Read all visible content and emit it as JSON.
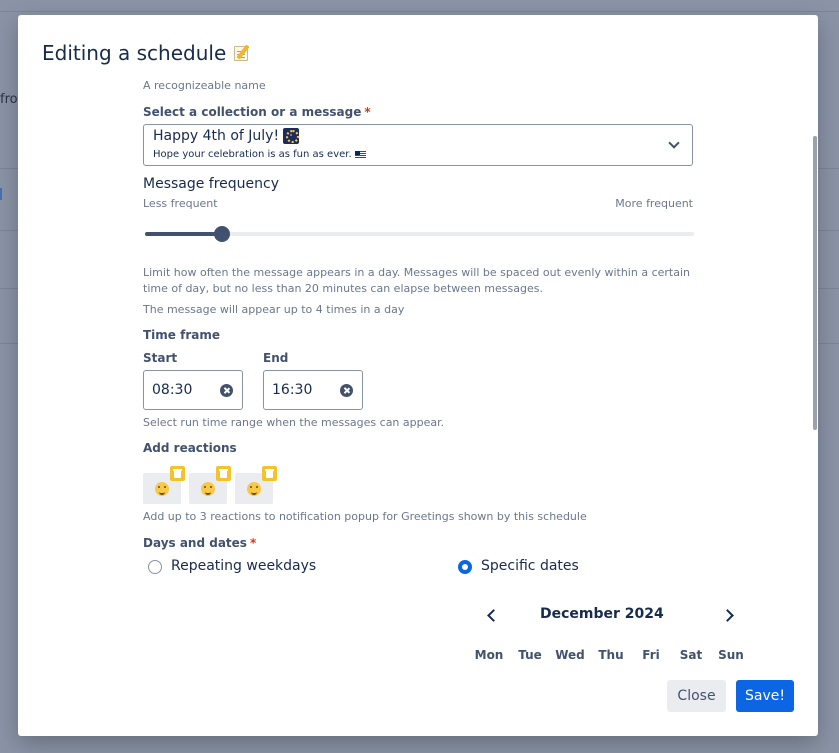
{
  "background": {
    "partial_text": "fron"
  },
  "modal": {
    "title": "Editing a schedule",
    "title_icon": "memo-icon"
  },
  "name_hint": "A recognizeable name",
  "collection": {
    "label": "Select a collection or a message",
    "required_mark": "*",
    "selected_title": "Happy 4th of July!",
    "selected_title_icon": "fireworks-icon",
    "selected_subtitle": "Hope your celebration is as fun as ever.",
    "selected_subtitle_icon": "us-flag-icon"
  },
  "frequency": {
    "title": "Message frequency",
    "min_label": "Less frequent",
    "max_label": "More frequent",
    "value_fraction": 0.14,
    "description": "Limit how often the message appears in a day. Messages will be spaced out evenly within a certain time of day, but no less than 20 minutes can elapse between messages.",
    "summary": "The message will appear up to 4 times in a day"
  },
  "time_frame": {
    "label": "Time frame",
    "start_label": "Start",
    "start_value": "08:30",
    "end_label": "End",
    "end_value": "16:30",
    "hint": "Select run time range when the messages can appear."
  },
  "reactions": {
    "label": "Add reactions",
    "items": [
      "grinning-sweat-emoji",
      "winking-emoji",
      "steaming-angry-emoji"
    ],
    "hint": "Add up to 3 reactions to notification popup for Greetings shown by this schedule"
  },
  "days": {
    "label": "Days and dates",
    "required_mark": "*",
    "option_weekdays": "Repeating weekdays",
    "option_dates": "Specific dates",
    "selected": "Specific dates"
  },
  "calendar": {
    "month_title": "December 2024",
    "weekdays": [
      "Mon",
      "Tue",
      "Wed",
      "Thu",
      "Fri",
      "Sat",
      "Sun"
    ]
  },
  "footer": {
    "close_label": "Close",
    "save_label": "Save!"
  },
  "colors": {
    "primary": "#0c66e4",
    "text": "#172b4d",
    "muted": "#6b778c",
    "required": "#de350b",
    "trash_badge": "#f4c22b"
  }
}
